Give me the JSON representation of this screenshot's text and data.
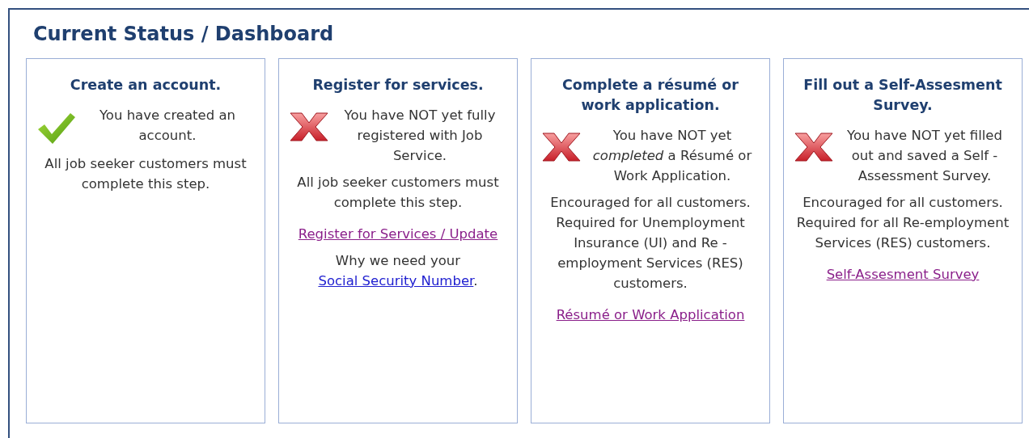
{
  "panel": {
    "title": "Current Status / Dashboard"
  },
  "cards": [
    {
      "title": "Create an account.",
      "complete": true,
      "status": "You have created an account.",
      "note": "All job seeker customers must complete this step."
    },
    {
      "title": "Register for services.",
      "complete": false,
      "status": "You have NOT yet fully registered with Job Service.",
      "note": "All job seeker customers must complete this step.",
      "link": "Register for Services / Update",
      "why": {
        "before": "Why we need your",
        "link": "Social Security Number",
        "after": "."
      }
    },
    {
      "title": "Complete a résumé or work application.",
      "complete": false,
      "status": "You have NOT yet *completed* a Résumé or Work Application.",
      "note": "Encouraged for all customers. Required for Unemployment Insurance (UI) and Re -employment Services (RES) customers.",
      "link": "Résumé or Work Application"
    },
    {
      "title": "Fill out a Self-Assesment Survey.",
      "complete": false,
      "status": "You have NOT yet filled out and saved a Self -Assessment Survey.",
      "note": "Encouraged for all customers. Required for all Re-employment Services (RES) customers.",
      "link": "Self-Assesment Survey"
    }
  ]
}
